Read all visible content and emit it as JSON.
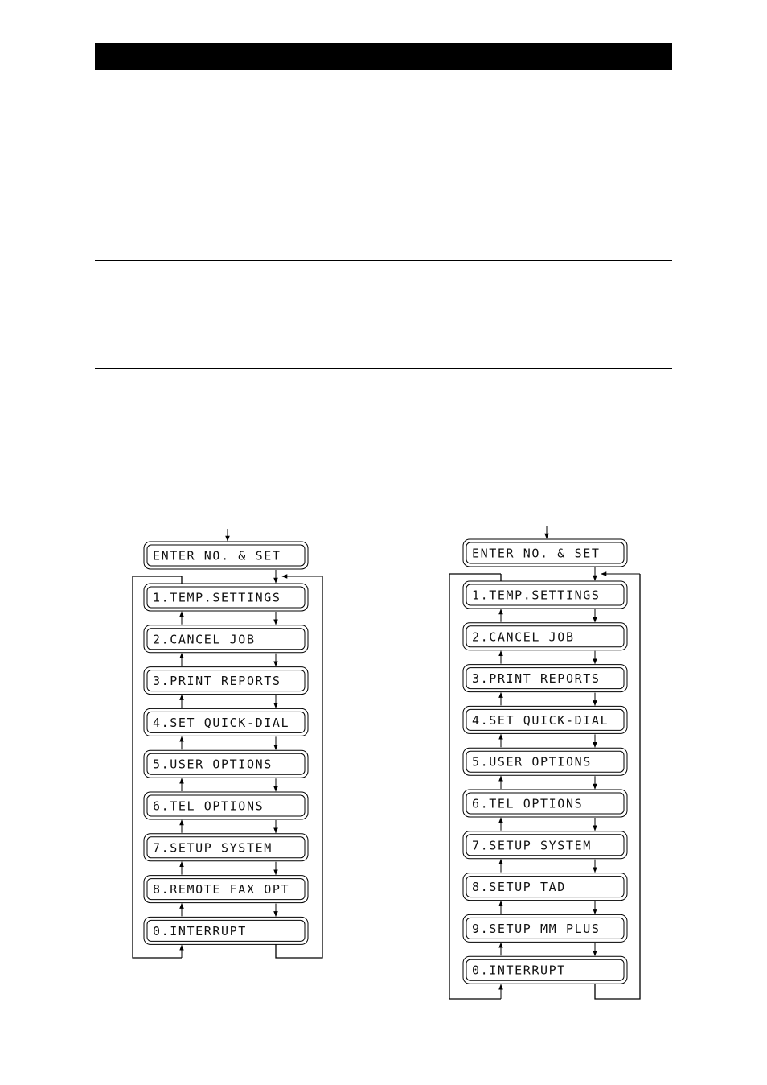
{
  "page": {
    "header_bar_color": "#000000",
    "line_color": "#000000"
  },
  "diagrams": [
    {
      "entry_label": "ENTER NO. & SET",
      "items": [
        "1.TEMP.SETTINGS",
        "2.CANCEL JOB",
        "3.PRINT REPORTS",
        "4.SET QUICK-DIAL",
        "5.USER OPTIONS",
        "6.TEL OPTIONS",
        "7.SETUP SYSTEM",
        "8.REMOTE FAX OPT",
        "0.INTERRUPT"
      ]
    },
    {
      "entry_label": "ENTER NO. & SET",
      "items": [
        "1.TEMP.SETTINGS",
        "2.CANCEL JOB",
        "3.PRINT REPORTS",
        "4.SET QUICK-DIAL",
        "5.USER OPTIONS",
        "6.TEL OPTIONS",
        "7.SETUP SYSTEM",
        "8.SETUP TAD",
        "9.SETUP MM PLUS",
        "0.INTERRUPT"
      ]
    }
  ]
}
